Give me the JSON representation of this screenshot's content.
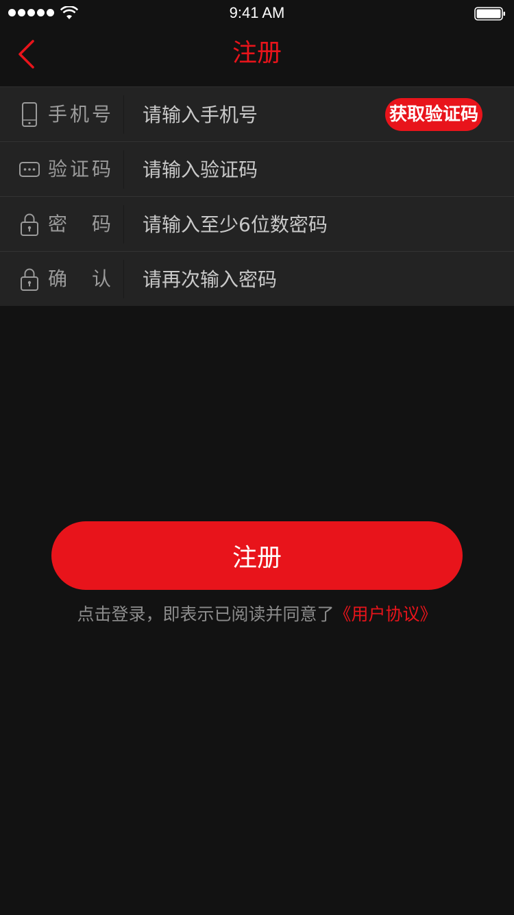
{
  "status_bar": {
    "time": "9:41 AM"
  },
  "nav": {
    "title": "注册"
  },
  "form": {
    "rows": [
      {
        "label": "手机号",
        "placeholder": "请输入手机号",
        "icon": "phone-icon"
      },
      {
        "label": "验证码",
        "placeholder": "请输入验证码",
        "icon": "message-dots-icon"
      },
      {
        "label": "密码",
        "placeholder": "请输入至少6位数密码",
        "icon": "lock-icon"
      },
      {
        "label": "确认",
        "placeholder": "请再次输入密码",
        "icon": "lock-icon"
      }
    ],
    "code_button_label": "获取验证码"
  },
  "register_button_label": "注册",
  "agreement": {
    "text": "点击登录，即表示已阅读并同意了",
    "link_text": "《用户协议》"
  },
  "colors": {
    "accent": "#e8141b",
    "background": "#121212",
    "form_background": "#232323"
  }
}
